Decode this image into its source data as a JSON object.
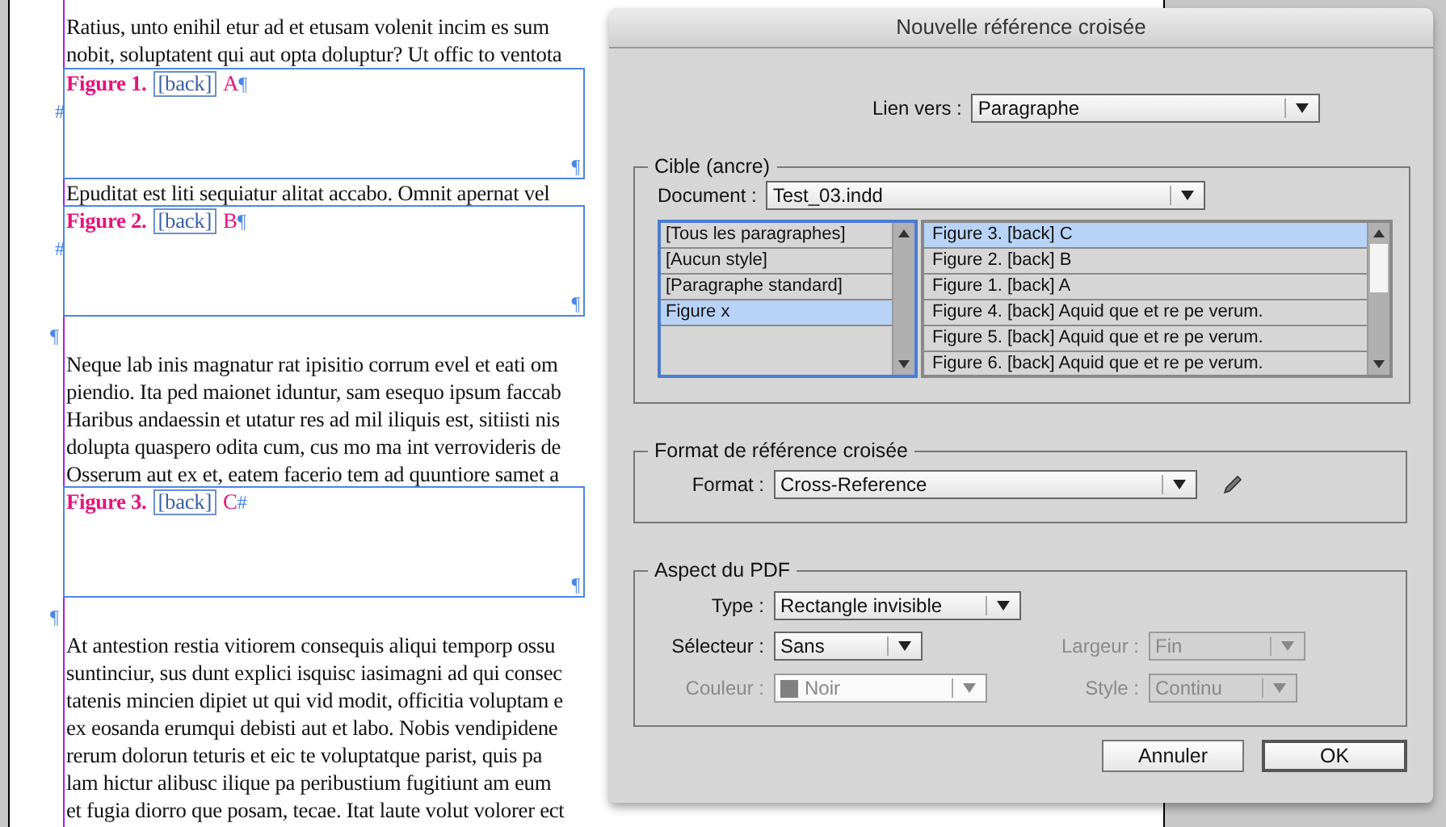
{
  "document": {
    "blocks": [
      {
        "kind": "text",
        "lines": [
          "Ratius, unto enihil etur ad et etusam volenit incim es sum",
          "nobit, soluptatent qui aut opta doluptur? Ut offic to ventota"
        ]
      },
      {
        "kind": "frame",
        "figure": "Figure 1.",
        "link": "[back]",
        "letter": "A",
        "end_mark": "¶",
        "anchor": "#",
        "corner_mark": "¶"
      },
      {
        "kind": "text",
        "lines": [
          "Epuditat est liti sequiatur alitat accabo. Omnit apernat vel"
        ]
      },
      {
        "kind": "frame",
        "figure": "Figure 2.",
        "link": "[back]",
        "letter": "B",
        "end_mark": "¶",
        "anchor": "#",
        "corner_mark": "¶"
      },
      {
        "kind": "pilcrow",
        "mark": "¶"
      },
      {
        "kind": "text",
        "lines": [
          "Neque lab inis magnatur rat ipisitio corrum evel et eati om",
          "piendio. Ita ped maionet iduntur, sam esequo ipsum faccab",
          "Haribus andaessin et utatur res ad mil iliquis est, sitiisti nis",
          "dolupta quaspero odita cum, cus mo ma int verrovideris de",
          "Osserum aut ex et, eatem facerio tem ad quuntiore samet a"
        ]
      },
      {
        "kind": "frame",
        "figure": "Figure 3.",
        "link": "[back]",
        "letter": "C",
        "end_mark": "#",
        "corner_mark": "¶"
      },
      {
        "kind": "pilcrow",
        "mark": "¶"
      },
      {
        "kind": "text",
        "lines": [
          "At antestion restia vitiorem consequis aliqui temporp ossu",
          "suntinciur, sus dunt explici isquisc iasimagni ad qui consec",
          "tatenis mincien dipiet ut qui vid modit, officitia voluptam e",
          "ex eosanda erumqui debisti aut et labo. Nobis vendipidene",
          "rerum dolorun teturis et eic te voluptatque parist, quis pa",
          "lam hictur alibusc ilique pa peribustium fugitiunt am eum",
          "et fugia diorro que posam, tecae. Itat laute volut volorer ect"
        ]
      }
    ]
  },
  "dialog": {
    "title": "Nouvelle référence croisée",
    "link_to": {
      "label": "Lien vers :",
      "value": "Paragraphe"
    },
    "target": {
      "legend": "Cible (ancre)",
      "document": {
        "label": "Document :",
        "value": "Test_03.indd"
      },
      "styles": [
        {
          "label": "[Tous les paragraphes]",
          "selected": false
        },
        {
          "label": "[Aucun style]",
          "selected": false
        },
        {
          "label": "[Paragraphe standard]",
          "selected": false
        },
        {
          "label": "Figure x",
          "selected": true
        }
      ],
      "paragraphs": [
        {
          "label": "Figure 3.  [back] C",
          "selected": true
        },
        {
          "label": "Figure 2.  [back] B",
          "selected": false
        },
        {
          "label": "Figure 1.  [back] A",
          "selected": false
        },
        {
          "label": "Figure 4.  [back] Aquid que et re pe verum.",
          "selected": false
        },
        {
          "label": "Figure 5.  [back] Aquid que et re pe verum.",
          "selected": false
        },
        {
          "label": "Figure 6.  [back] Aquid que et re pe verum.",
          "selected": false
        }
      ]
    },
    "format_group": {
      "legend": "Format de référence croisée",
      "format": {
        "label": "Format :",
        "value": "Cross-Reference"
      }
    },
    "pdf": {
      "legend": "Aspect du PDF",
      "type": {
        "label": "Type :",
        "value": "Rectangle invisible",
        "disabled": false
      },
      "selector": {
        "label": "Sélecteur :",
        "value": "Sans",
        "disabled": false
      },
      "width": {
        "label": "Largeur :",
        "value": "Fin",
        "disabled": true
      },
      "color": {
        "label": "Couleur :",
        "value": "Noir",
        "disabled": true
      },
      "style": {
        "label": "Style :",
        "value": "Continu",
        "disabled": true
      }
    },
    "buttons": [
      {
        "label": "Annuler",
        "default": false
      },
      {
        "label": "OK",
        "default": true
      }
    ]
  }
}
